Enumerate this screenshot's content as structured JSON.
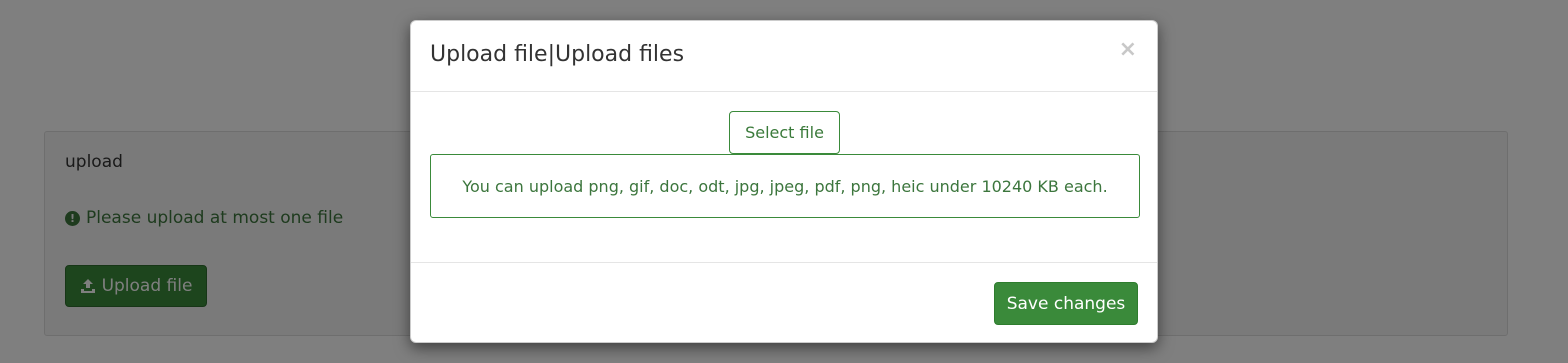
{
  "card": {
    "title": "upload",
    "warning": "Please upload at most one file",
    "warning_icon": "exclamation-circle-icon",
    "upload_button": "Upload file",
    "upload_icon": "upload-icon"
  },
  "modal": {
    "title": "Upload file|Upload files",
    "close_label": "×",
    "select_button": "Select file",
    "info_text": "You can upload png, gif, doc, odt, jpg, jpeg, pdf, png, heic under 10240 KB each.",
    "save_button": "Save changes"
  },
  "colors": {
    "accent_green": "#3a8a3a",
    "text_green": "#3c763d",
    "overlay": "rgba(0,0,0,0.5)"
  }
}
